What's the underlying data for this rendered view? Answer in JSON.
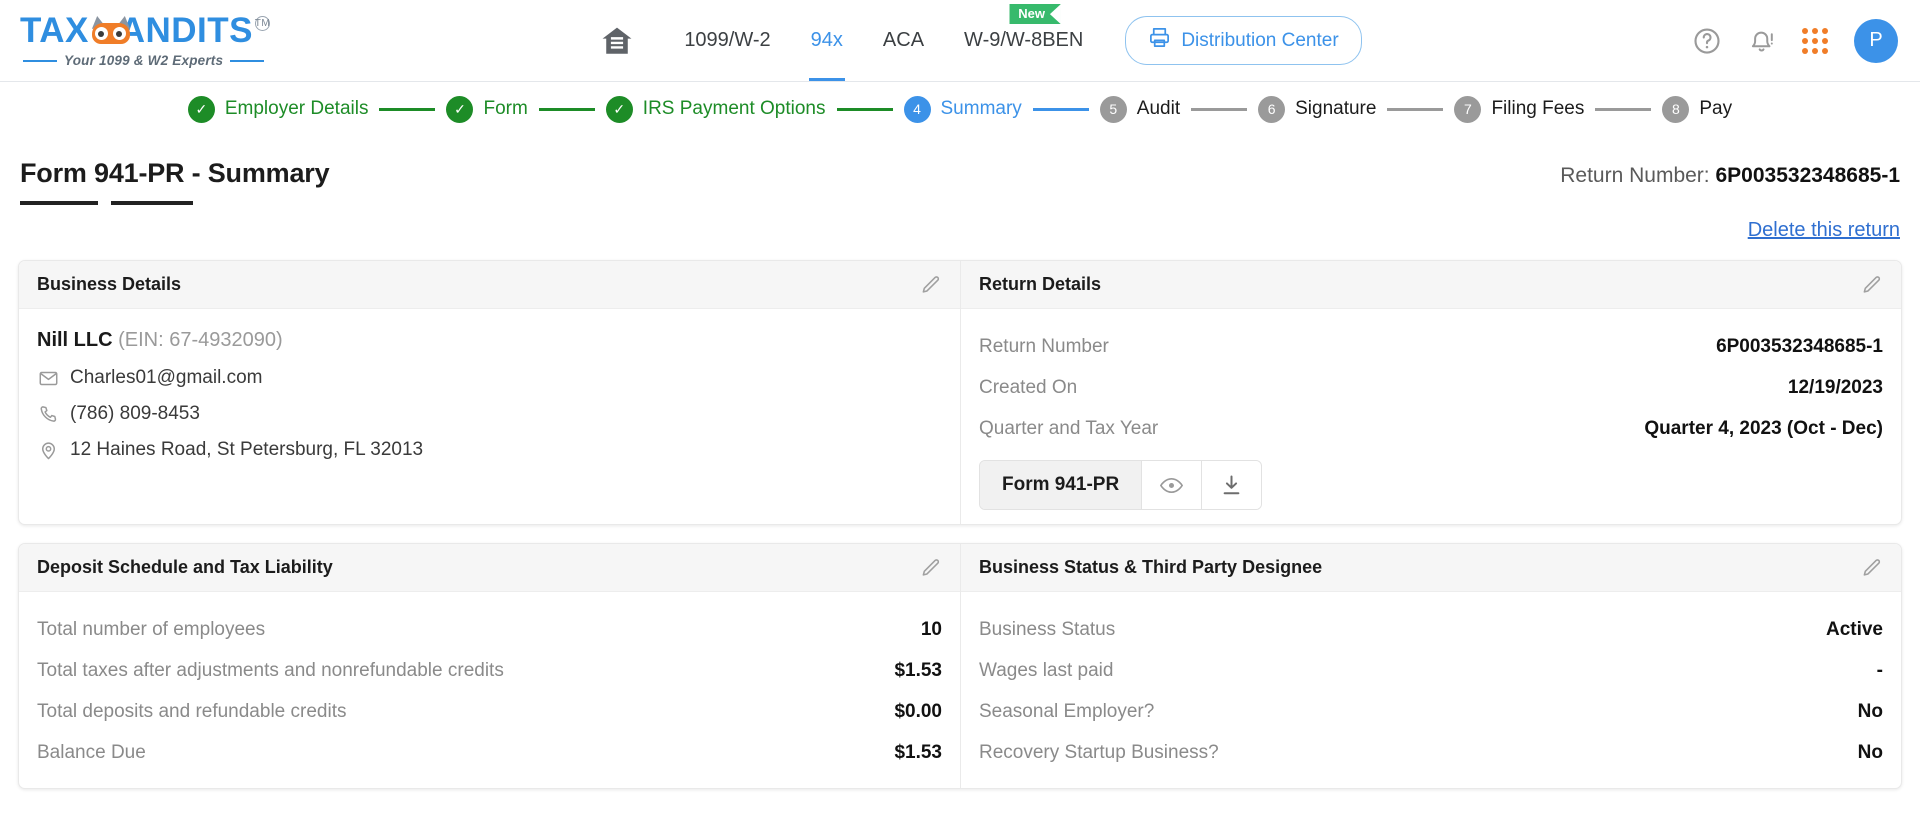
{
  "brand": {
    "name_part1": "TAX",
    "name_part2": "ANDITS",
    "tm": "TM",
    "tagline": "Your 1099 & W2 Experts",
    "accent": "#2f8ee0",
    "accent_orange": "#f07d28"
  },
  "header": {
    "home_icon": "home-icon",
    "nav": [
      {
        "label": "1099/W-2",
        "active": false,
        "badge": null
      },
      {
        "label": "94x",
        "active": true,
        "badge": null
      },
      {
        "label": "ACA",
        "active": false,
        "badge": null
      },
      {
        "label": "W-9/W-8BEN",
        "active": false,
        "badge": "New"
      }
    ],
    "distribution_button": "Distribution Center",
    "distribution_icon": "printer-icon",
    "help_icon": "help-circle-icon",
    "notification_icon": "bell-alert-icon",
    "apps_icon": "grid-apps-icon",
    "avatar_initial": "P"
  },
  "stepper": [
    {
      "num": "1",
      "label": "Employer Details",
      "state": "done",
      "mark": "✓"
    },
    {
      "num": "2",
      "label": "Form",
      "state": "done",
      "mark": "✓"
    },
    {
      "num": "3",
      "label": "IRS Payment Options",
      "state": "done",
      "mark": "✓"
    },
    {
      "num": "4",
      "label": "Summary",
      "state": "current",
      "mark": "4"
    },
    {
      "num": "5",
      "label": "Audit",
      "state": "todo",
      "mark": "5"
    },
    {
      "num": "6",
      "label": "Signature",
      "state": "todo",
      "mark": "6"
    },
    {
      "num": "7",
      "label": "Filing Fees",
      "state": "todo",
      "mark": "7"
    },
    {
      "num": "8",
      "label": "Pay",
      "state": "todo",
      "mark": "8"
    }
  ],
  "page": {
    "title": "Form 941-PR - Summary",
    "return_number_label": "Return Number:",
    "return_number_value": "6P003532348685-1",
    "delete_link": "Delete this return"
  },
  "business_details": {
    "title": "Business Details",
    "edit_icon": "pencil-icon",
    "name": "Nill LLC",
    "ein": "(EIN: 67-4932090)",
    "email": "Charles01@gmail.com",
    "email_icon": "envelope-icon",
    "phone": "(786) 809-8453",
    "phone_icon": "phone-icon",
    "address": "12 Haines Road, St Petersburg, FL 32013",
    "address_icon": "location-pin-icon"
  },
  "return_details": {
    "title": "Return Details",
    "edit_icon": "pencil-icon",
    "rows": [
      {
        "label": "Return Number",
        "value": "6P003532348685-1"
      },
      {
        "label": "Created On",
        "value": "12/19/2023"
      },
      {
        "label": "Quarter and Tax Year",
        "value": "Quarter 4, 2023 (Oct - Dec)"
      }
    ],
    "form_button_label": "Form 941-PR",
    "preview_icon": "eye-icon",
    "download_icon": "download-icon"
  },
  "deposit_schedule": {
    "title": "Deposit Schedule and Tax Liability",
    "edit_icon": "pencil-icon",
    "rows": [
      {
        "label": "Total number of employees",
        "value": "10"
      },
      {
        "label": "Total taxes after adjustments and nonrefundable credits",
        "value": "$1.53"
      },
      {
        "label": "Total deposits and refundable credits",
        "value": "$0.00"
      },
      {
        "label": "Balance Due",
        "value": "$1.53"
      }
    ]
  },
  "business_status": {
    "title": "Business Status & Third Party Designee",
    "edit_icon": "pencil-icon",
    "rows": [
      {
        "label": "Business Status",
        "value": "Active"
      },
      {
        "label": "Wages last paid",
        "value": "-"
      },
      {
        "label": "Seasonal Employer?",
        "value": "No"
      },
      {
        "label": "Recovery Startup Business?",
        "value": "No"
      }
    ]
  }
}
